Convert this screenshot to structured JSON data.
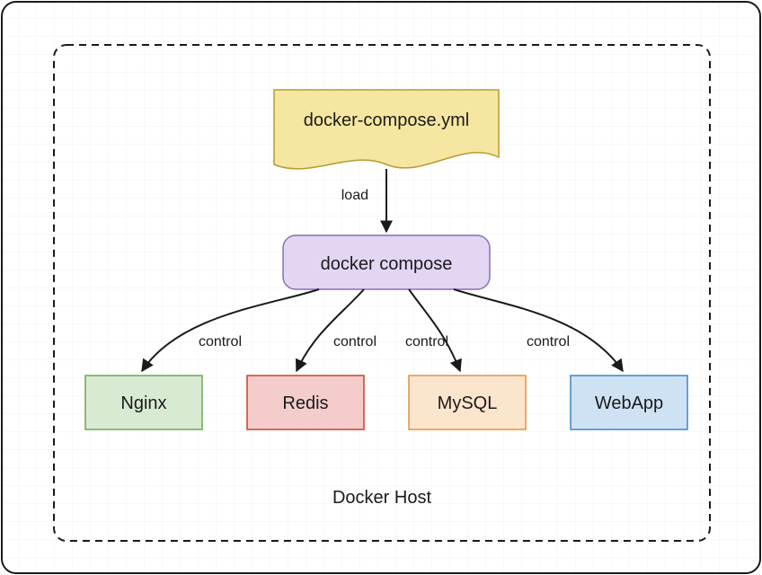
{
  "diagram": {
    "container_label": "Docker Host",
    "file_node": {
      "label": "docker-compose.yml"
    },
    "compose_node": {
      "label": "docker compose"
    },
    "services": {
      "nginx": {
        "label": "Nginx"
      },
      "redis": {
        "label": "Redis"
      },
      "mysql": {
        "label": "MySQL"
      },
      "webapp": {
        "label": "WebApp"
      }
    },
    "edge_labels": {
      "load": "load",
      "control1": "control",
      "control2": "control",
      "control3": "control",
      "control4": "control"
    }
  },
  "colors": {
    "file_fill": "#f5e7a1",
    "file_stroke": "#b79b2e",
    "compose_fill": "#e2d6f3",
    "compose_stroke": "#8b6fb3",
    "nginx_fill": "#d9ead3",
    "nginx_stroke": "#6aa84f",
    "redis_fill": "#f4cccc",
    "redis_stroke": "#cc4125",
    "mysql_fill": "#fce5cd",
    "mysql_stroke": "#e69138",
    "webapp_fill": "#cfe2f3",
    "webapp_stroke": "#3d85c6",
    "text": "#1a1a1a",
    "dash": "#1a1a1a",
    "grid": "#eef3f3"
  }
}
